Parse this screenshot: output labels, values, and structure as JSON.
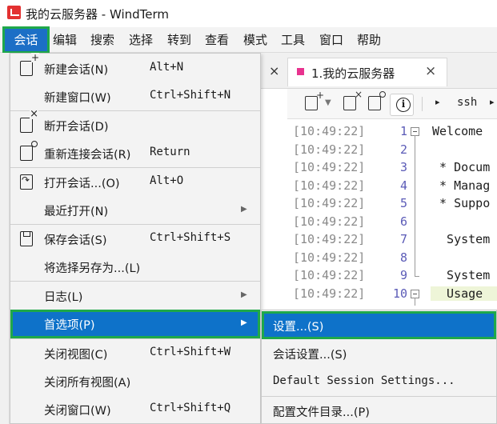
{
  "window": {
    "title": "我的云服务器 - WindTerm"
  },
  "menubar": {
    "items": [
      "会话",
      "编辑",
      "搜索",
      "选择",
      "转到",
      "查看",
      "模式",
      "工具",
      "窗口",
      "帮助"
    ],
    "active": "会话"
  },
  "session_tab": {
    "title": "1.我的云服务器",
    "close": "×"
  },
  "side_pane_close": "×",
  "toolbar": {
    "ssh_label": "ssh",
    "icons": [
      "new-session-icon",
      "close-session-icon",
      "reconnect-icon",
      "info-icon"
    ]
  },
  "terminal": {
    "lines": [
      {
        "time": "[10:49:22]",
        "num": "1",
        "text": "Welcome"
      },
      {
        "time": "[10:49:22]",
        "num": "2",
        "text": ""
      },
      {
        "time": "[10:49:22]",
        "num": "3",
        "text": " * Docum"
      },
      {
        "time": "[10:49:22]",
        "num": "4",
        "text": " * Manag"
      },
      {
        "time": "[10:49:22]",
        "num": "5",
        "text": " * Suppo"
      },
      {
        "time": "[10:49:22]",
        "num": "6",
        "text": ""
      },
      {
        "time": "[10:49:22]",
        "num": "7",
        "text": "  System"
      },
      {
        "time": "[10:49:22]",
        "num": "8",
        "text": ""
      },
      {
        "time": "[10:49:22]",
        "num": "9",
        "text": "  System"
      },
      {
        "time": "[10:49:22]",
        "num": "10",
        "text": "  Usage"
      }
    ]
  },
  "session_menu": {
    "items": [
      {
        "label": "新建会话(N)",
        "accel": "Alt+N",
        "icon": "new-session-icon"
      },
      {
        "label": "新建窗口(W)",
        "accel": "Ctrl+Shift+N"
      },
      {
        "label": "断开会话(D)",
        "accel": "",
        "icon": "disconnect-icon"
      },
      {
        "label": "重新连接会话(R)",
        "accel": "Return",
        "icon": "reconnect-icon"
      },
      {
        "label": "打开会话...(O)",
        "accel": "Alt+O",
        "icon": "open-session-icon"
      },
      {
        "label": "最近打开(N)",
        "accel": "",
        "submenu": true
      },
      {
        "label": "保存会话(S)",
        "accel": "Ctrl+Shift+S",
        "icon": "save-icon"
      },
      {
        "label": "将选择另存为...(L)",
        "accel": ""
      },
      {
        "label": "日志(L)",
        "accel": "",
        "submenu": true
      },
      {
        "label": "首选项(P)",
        "accel": "",
        "submenu": true,
        "selected": true
      },
      {
        "label": "关闭视图(C)",
        "accel": "Ctrl+Shift+W"
      },
      {
        "label": "关闭所有视图(A)",
        "accel": ""
      },
      {
        "label": "关闭窗口(W)",
        "accel": "Ctrl+Shift+Q"
      }
    ]
  },
  "preferences_submenu": {
    "items": [
      {
        "label": "设置...(S)",
        "selected": true
      },
      {
        "label": "会话设置...(S)"
      },
      {
        "label": "Default Session Settings..."
      },
      {
        "label": "配置文件目录...(P)"
      }
    ]
  },
  "colors": {
    "selection_blue": "#0e72c9",
    "highlight_green": "#1fa84a",
    "app_icon_red": "#e33131",
    "tab_dot_pink": "#e8338f"
  }
}
